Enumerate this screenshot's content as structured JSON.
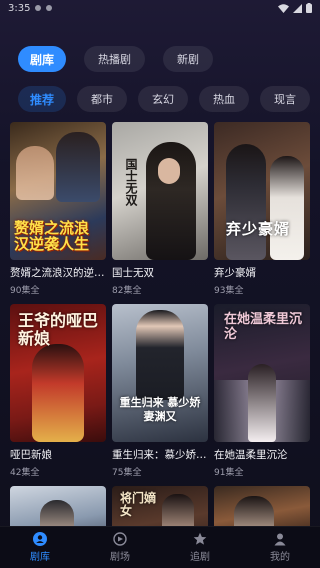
{
  "status": {
    "time": "3:35"
  },
  "tabs": [
    {
      "label": "剧库",
      "active": true
    },
    {
      "label": "热播剧",
      "active": false
    },
    {
      "label": "新剧",
      "active": false
    }
  ],
  "genres": [
    {
      "label": "推荐",
      "active": true
    },
    {
      "label": "都市",
      "active": false
    },
    {
      "label": "玄幻",
      "active": false
    },
    {
      "label": "热血",
      "active": false
    },
    {
      "label": "现言",
      "active": false
    }
  ],
  "dramas": [
    {
      "title": "赘婿之流浪汉的逆袭人生",
      "episodes": "90集全",
      "poster_text": "赘婿之流浪汉逆袭人生"
    },
    {
      "title": "国士无双",
      "episodes": "82集全",
      "poster_text": "国士无双"
    },
    {
      "title": "弃少豪婿",
      "episodes": "93集全",
      "poster_text": "弃少豪婿"
    },
    {
      "title": "哑巴新娘",
      "episodes": "42集全",
      "poster_text": "王爷的哑巴新娘"
    },
    {
      "title": "重生归来：慕少娇妻渊又",
      "episodes": "75集全",
      "poster_text": "重生归来 慕少娇妻渊又"
    },
    {
      "title": "在她温柔里沉沦",
      "episodes": "91集全",
      "poster_text": "在她温柔里沉沦"
    },
    {
      "title": "",
      "episodes": "",
      "poster_text": ""
    },
    {
      "title": "",
      "episodes": "",
      "poster_text": "将门嫡女"
    },
    {
      "title": "",
      "episodes": "",
      "poster_text": ""
    }
  ],
  "nav": [
    {
      "label": "剧库",
      "icon": "library-icon",
      "active": true
    },
    {
      "label": "剧场",
      "icon": "theater-icon",
      "active": false
    },
    {
      "label": "追剧",
      "icon": "star-icon",
      "active": false
    },
    {
      "label": "我的",
      "icon": "profile-icon",
      "active": false
    }
  ],
  "colors": {
    "accent": "#2f8cff",
    "background": "#141328"
  }
}
